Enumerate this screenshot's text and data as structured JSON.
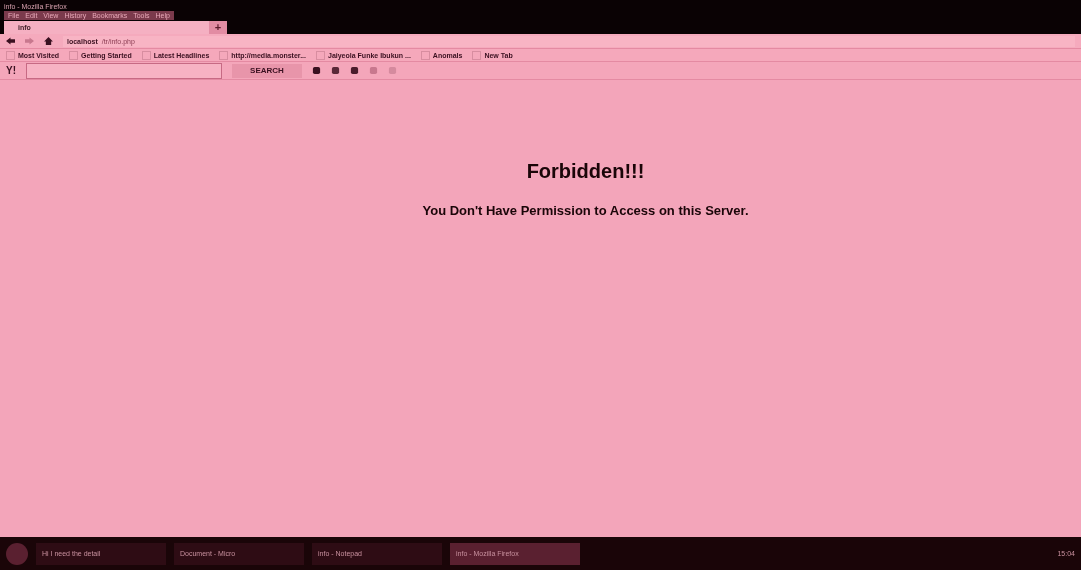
{
  "window": {
    "title": "info - Mozilla Firefox"
  },
  "menu": [
    "File",
    "Edit",
    "View",
    "History",
    "Bookmarks",
    "Tools",
    "Help"
  ],
  "tabs": [
    {
      "label": "info",
      "selected": true
    }
  ],
  "new_tab": "+",
  "address": {
    "host": "localhost",
    "path": "/tr/info.php"
  },
  "bookmarks": [
    "Most Visited",
    "Getting Started",
    "Latest Headlines",
    "http://media.monster...",
    "Jaiyeola Funke Ibukun ...",
    "Anomals",
    "New Tab"
  ],
  "yahoo_toolbar": {
    "logo": "Y!",
    "search_button": "SEARCH"
  },
  "page": {
    "heading": "Forbidden!!!",
    "message": "You Don't Have Permission to Access on this Server."
  },
  "taskbar": {
    "items": [
      {
        "label": "Hi I need the detail",
        "selected": false
      },
      {
        "label": "Document - Micro",
        "selected": false
      },
      {
        "label": "info - Notepad",
        "selected": false
      },
      {
        "label": "info - Mozilla Firefox",
        "selected": true
      }
    ],
    "clock": "15:04"
  }
}
